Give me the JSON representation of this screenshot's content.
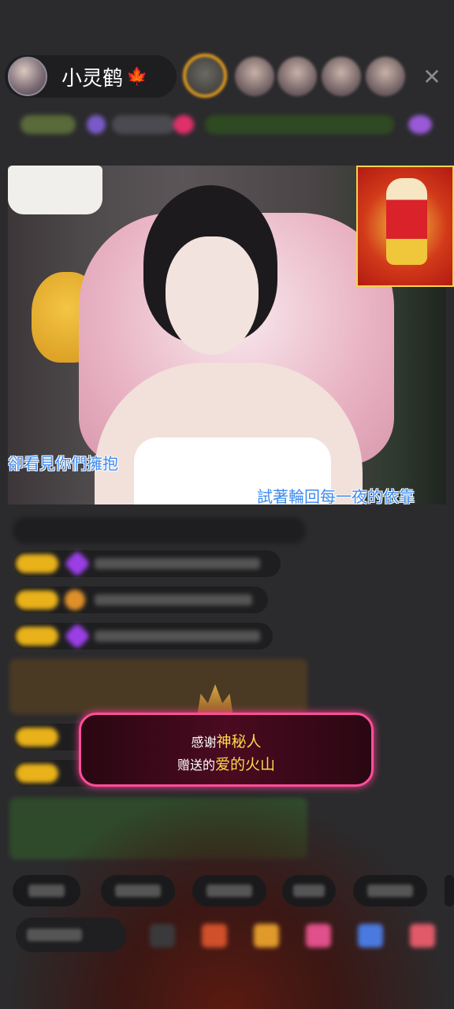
{
  "header": {
    "host_name": "小灵鹤",
    "host_badge_icon": "maple-leaf-icon"
  },
  "video": {
    "lyric_left": "卻看見你們擁抱",
    "lyric_right": "試著輪回每一夜的依靠"
  },
  "gift_popup": {
    "line1_prefix": "感谢",
    "sender": "神秘人",
    "line2_prefix": "赠送的",
    "gift_name": "爱的火山"
  },
  "colors": {
    "accent_pink": "#ff4f9b",
    "highlight_yellow": "#ffd84a",
    "lyric_blue": "#3d8bf0",
    "badge_gold": "#e9b21a"
  }
}
